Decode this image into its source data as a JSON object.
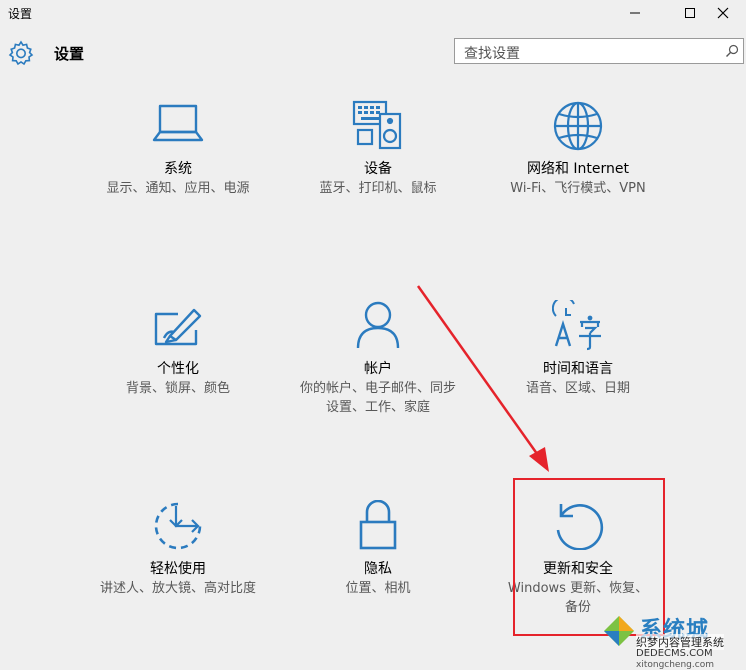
{
  "window": {
    "title": "设置",
    "controls": [
      "minimize-icon",
      "maximize-icon",
      "close-icon"
    ]
  },
  "header": {
    "title": "设置",
    "icon": "gear-icon"
  },
  "search": {
    "placeholder": "查找设置",
    "icon": "search-icon"
  },
  "accent_color": "#2b7bbf",
  "highlight_color": "#e5232b",
  "tiles": [
    {
      "icon": "laptop-icon",
      "name": "系统",
      "desc": "显示、通知、应用、电源"
    },
    {
      "icon": "devices-icon",
      "name": "设备",
      "desc": "蓝牙、打印机、鼠标"
    },
    {
      "icon": "globe-icon",
      "name": "网络和 Internet",
      "desc": "Wi-Fi、飞行模式、VPN"
    },
    {
      "icon": "personalization-icon",
      "name": "个性化",
      "desc": "背景、锁屏、颜色"
    },
    {
      "icon": "user-icon",
      "name": "帐户",
      "desc": "你的帐户、电子邮件、同步设置、工作、家庭"
    },
    {
      "icon": "time-language-icon",
      "name": "时间和语言",
      "desc": "语音、区域、日期"
    },
    {
      "icon": "ease-of-access-icon",
      "name": "轻松使用",
      "desc": "讲述人、放大镜、高对比度"
    },
    {
      "icon": "lock-icon",
      "name": "隐私",
      "desc": "位置、相机"
    },
    {
      "icon": "update-icon",
      "name": "更新和安全",
      "desc": "Windows 更新、恢复、备份"
    }
  ],
  "watermark": {
    "brand": "系统城",
    "line1": "织梦内容管理系统",
    "line2": "DEDECMS.COM",
    "line3": "xitongcheng.com"
  }
}
